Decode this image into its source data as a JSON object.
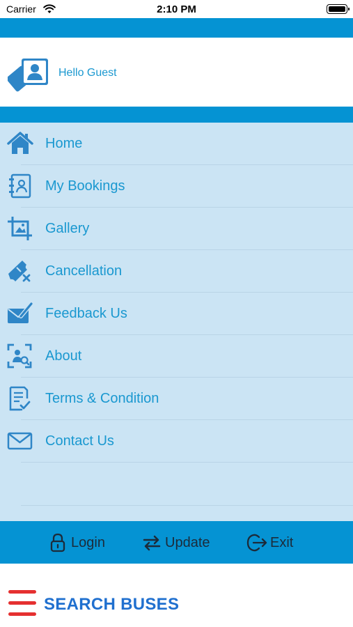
{
  "status_bar": {
    "carrier": "Carrier",
    "time": "2:10 PM"
  },
  "profile": {
    "greeting": "Hello Guest",
    "avatar_icon": "user-card-icon"
  },
  "menu": {
    "items": [
      {
        "label": "Home",
        "icon": "home-icon"
      },
      {
        "label": "My Bookings",
        "icon": "bookings-icon"
      },
      {
        "label": "Gallery",
        "icon": "gallery-icon"
      },
      {
        "label": "Cancellation",
        "icon": "cancel-ticket-icon"
      },
      {
        "label": "Feedback Us",
        "icon": "feedback-icon"
      },
      {
        "label": "About",
        "icon": "about-icon"
      },
      {
        "label": "Terms & Condition",
        "icon": "terms-icon"
      },
      {
        "label": "Contact Us",
        "icon": "mail-icon"
      }
    ]
  },
  "bottom_bar": {
    "login_label": "Login",
    "update_label": "Update",
    "exit_label": "Exit"
  },
  "search": {
    "title": "SEARCH BUSES",
    "menu_icon": "hamburger-icon"
  },
  "colors": {
    "primary": "#0593d3",
    "menu_bg": "#cbe4f4",
    "menu_text": "#1a98d0",
    "icon": "#2f86c7",
    "search_title": "#2070cf",
    "hamburger": "#e53030"
  }
}
